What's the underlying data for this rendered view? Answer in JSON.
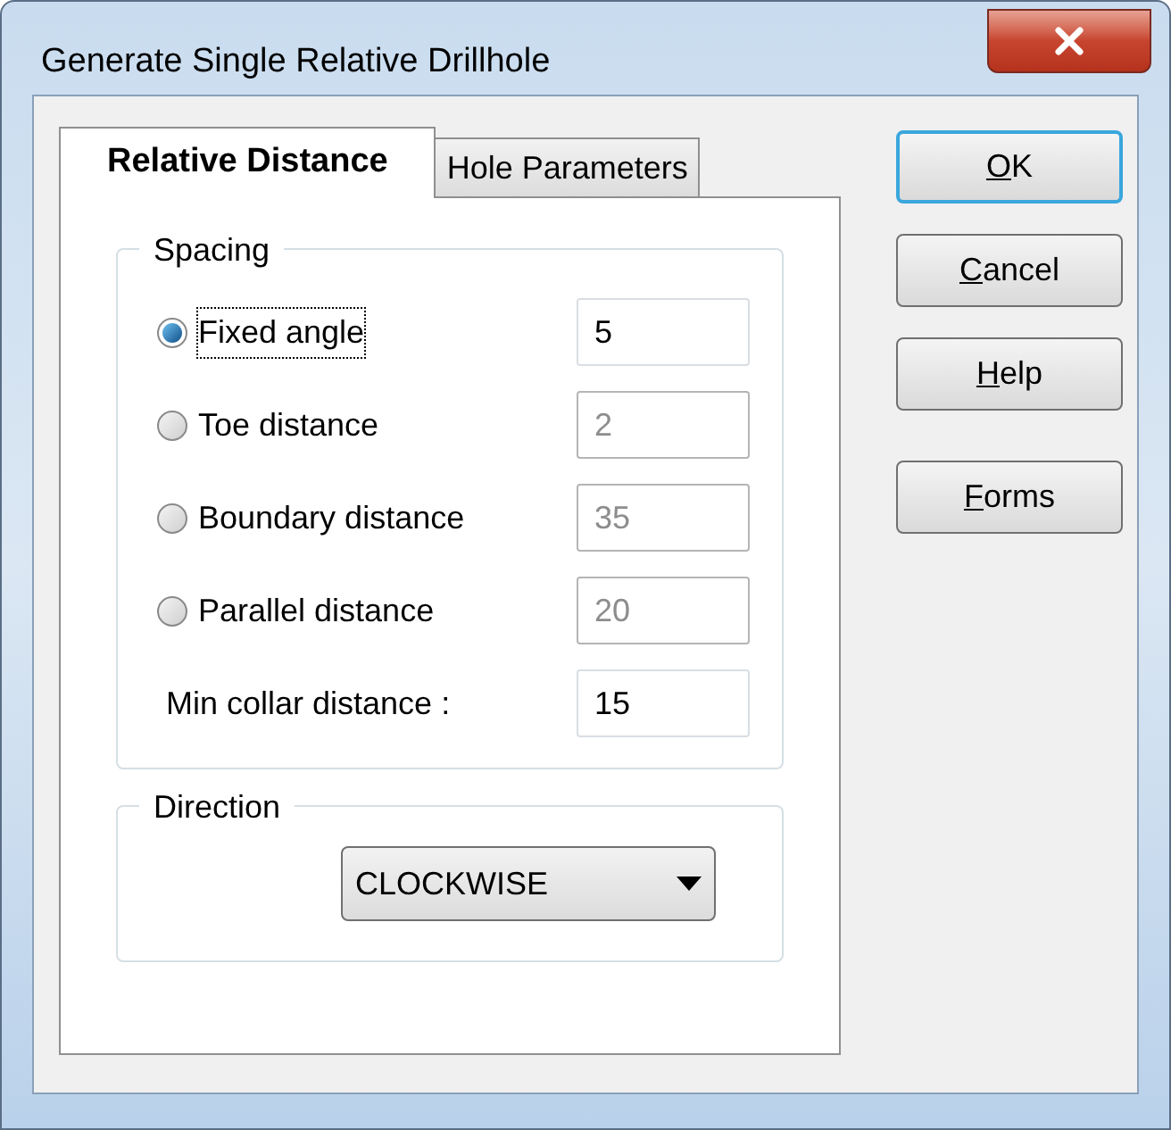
{
  "window": {
    "title": "Generate Single Relative Drillhole"
  },
  "tabs": [
    {
      "label": "Relative Distance",
      "selected": true
    },
    {
      "label": "Hole Parameters",
      "selected": false
    }
  ],
  "spacing": {
    "title": "Spacing",
    "rows": [
      {
        "kind": "radio",
        "label": "Fixed angle",
        "selected": true,
        "focused": true,
        "value": "5",
        "disabled": false
      },
      {
        "kind": "radio",
        "label": "Toe distance",
        "selected": false,
        "focused": false,
        "value": "2",
        "disabled": true
      },
      {
        "kind": "radio",
        "label": "Boundary distance",
        "selected": false,
        "focused": false,
        "value": "35",
        "disabled": true
      },
      {
        "kind": "radio",
        "label": "Parallel distance",
        "selected": false,
        "focused": false,
        "value": "20",
        "disabled": true
      },
      {
        "kind": "label",
        "label": "Min collar distance :",
        "value": "15",
        "disabled": false
      }
    ]
  },
  "direction": {
    "title": "Direction",
    "value": "CLOCKWISE"
  },
  "buttons": [
    {
      "label": "OK",
      "default": true,
      "mnemonic": true
    },
    {
      "label": "Cancel",
      "default": false,
      "mnemonic": true
    },
    {
      "label": "Help",
      "default": false,
      "mnemonic": true
    },
    {
      "label": "Forms",
      "default": false,
      "mnemonic": true
    }
  ]
}
